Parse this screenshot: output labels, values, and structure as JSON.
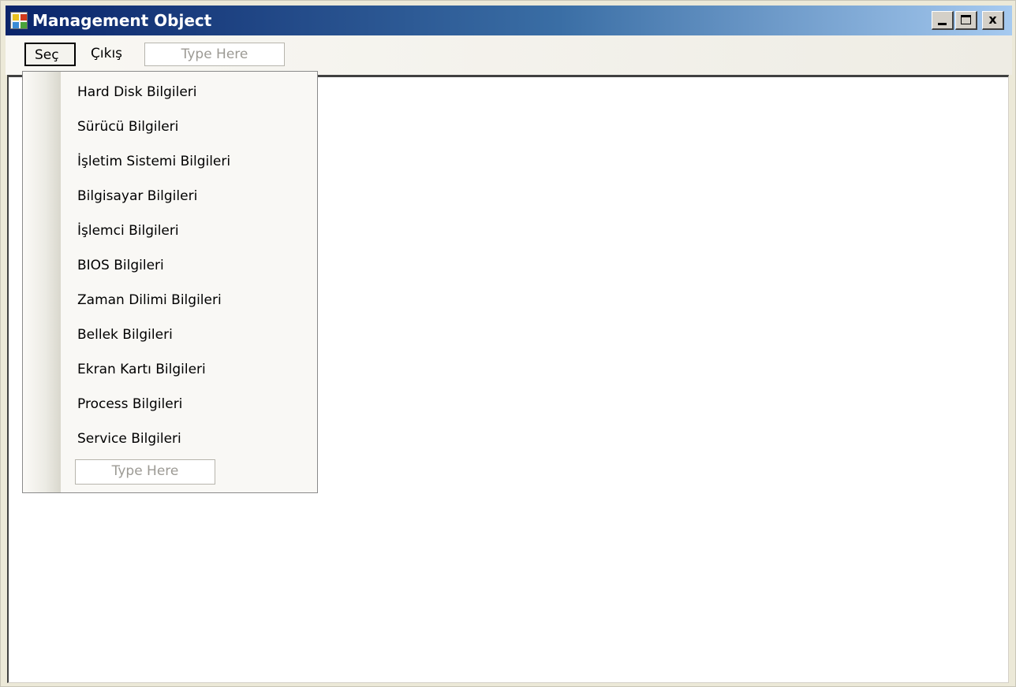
{
  "window": {
    "title": "Management Object",
    "buttons": {
      "minimize": "",
      "maximize": "",
      "close": "x"
    }
  },
  "menubar": {
    "items": [
      {
        "label": "Seç"
      },
      {
        "label": "Çıkış"
      }
    ],
    "type_here": "Type Here"
  },
  "dropdown": {
    "items": [
      {
        "label": "Hard Disk Bilgileri"
      },
      {
        "label": "Sürücü Bilgileri"
      },
      {
        "label": "İşletim Sistemi Bilgileri"
      },
      {
        "label": "Bilgisayar Bilgileri"
      },
      {
        "label": "İşlemci Bilgileri"
      },
      {
        "label": "BIOS Bilgileri"
      },
      {
        "label": "Zaman Dilimi Bilgileri"
      },
      {
        "label": "Bellek Bilgileri"
      },
      {
        "label": "Ekran Kartı Bilgileri"
      },
      {
        "label": "Process Bilgileri"
      },
      {
        "label": "Service Bilgileri"
      }
    ],
    "type_here": "Type Here"
  },
  "colors": {
    "title_gradient_start": "#0a246a",
    "title_gradient_end": "#a6caf0",
    "title_text": "#ffffff",
    "placeholder_text": "#9c9a94"
  },
  "icons": {
    "app": "app-icon",
    "minimize": "minimize-icon",
    "maximize": "maximize-icon",
    "close": "close-icon"
  }
}
